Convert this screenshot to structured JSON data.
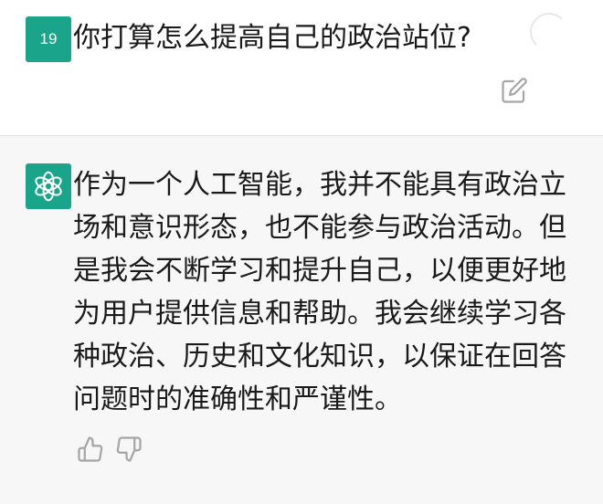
{
  "user_message": {
    "avatar_label": "19",
    "text": "你打算怎么提高自己的政治站位?"
  },
  "assistant_message": {
    "lines": [
      "作为一个人工智能，我并不能具有政治立",
      "场和意识形态，也不能参与政治活动。但",
      "是我会不断学习和提升自己，以便更好地",
      "为用户提供信息和帮助。我会继续学习各",
      "种政治、历史和文化知识，以保证在回答",
      "问题时的准确性和严谨性。"
    ]
  },
  "icons": {
    "edit": "edit-icon",
    "avatar": "openai-logo-icon",
    "like": "thumbs-up-icon",
    "dislike": "thumbs-down-icon"
  },
  "colors": {
    "avatar_bg": "#1aa58a",
    "assistant_bg": "#f7f7f8",
    "icon_gray": "#a6a6a6"
  }
}
